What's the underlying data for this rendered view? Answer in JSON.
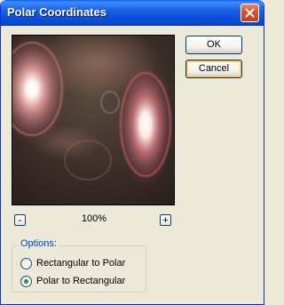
{
  "window": {
    "title": "Polar Coordinates",
    "close_icon": "close-icon"
  },
  "buttons": {
    "ok_label": "OK",
    "cancel_label": "Cancel"
  },
  "preview": {
    "zoom_level": "100%",
    "zoom_out_label": "-",
    "zoom_in_label": "+"
  },
  "options": {
    "legend": "Options:",
    "items": [
      {
        "label": "Rectangular to Polar",
        "checked": false
      },
      {
        "label": "Polar to Rectangular",
        "checked": true
      }
    ]
  },
  "colors": {
    "titlebar": "#0a49d0",
    "dialog_bg": "#ece9d8",
    "legend_text": "#0046d5",
    "radio_dot": "#21a121"
  }
}
